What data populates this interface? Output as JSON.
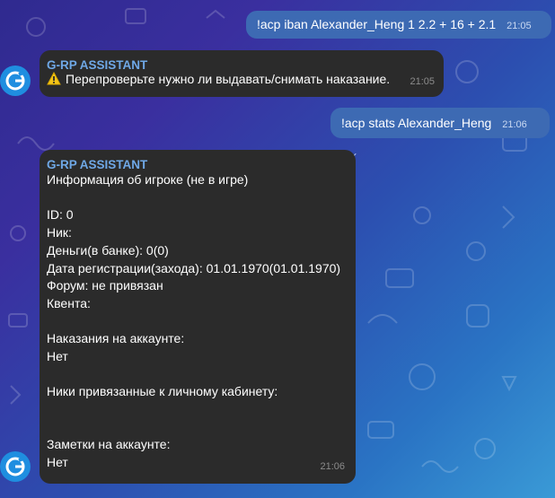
{
  "outgoing": [
    {
      "text": "!acp iban Alexander_Heng 1 2.2 + 16 + 2.1",
      "time": "21:05"
    },
    {
      "text": "!acp stats Alexander_Heng",
      "time": "21:06"
    }
  ],
  "incoming": [
    {
      "sender": "G-RP ASSISTANT",
      "text": "Перепроверьте нужно ли выдавать/снимать наказание.",
      "time": "21:05"
    },
    {
      "sender": "G-RP ASSISTANT",
      "lines": [
        "Информация об игроке  (не в игре)",
        "",
        "ID: 0",
        "Ник:",
        "Деньги(в банке): 0(0)",
        "Дата регистрации(захода): 01.01.1970(01.01.1970)",
        "Форум: не привязан",
        "Квента:",
        "",
        "Наказания на аккаунте:",
        "Нет",
        "",
        "Ники привязанные к личному кабинету:",
        "",
        "",
        "Заметки на аккаунте:",
        "Нет"
      ],
      "time": "21:06"
    }
  ],
  "icons": {
    "avatar": "g-logo-icon",
    "warning": "warning-icon",
    "read_receipt": "double-check-icon"
  },
  "colors": {
    "outgoing_bubble": "#3d6ab3",
    "incoming_bubble": "#2b2b2b",
    "sender_name": "#6fa8e6"
  }
}
